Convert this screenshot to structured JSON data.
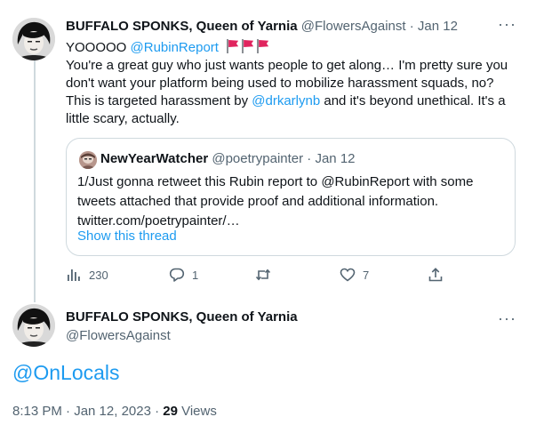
{
  "tweet1": {
    "author_name": "BUFFALO SPONKS, Queen of Yarnia",
    "handle": "@FlowersAgainst",
    "separator": "·",
    "date": "Jan 12",
    "more": "···",
    "line1_prefix": "YOOOOO ",
    "line1_mention": "@RubinReport",
    "body_part1": "You're a great guy who just wants people to get along… I'm pretty sure you don't want your platform being used to mobilize harassment squads, no? This is targeted harassment by ",
    "body_mention": "@drkarlynb",
    "body_part2": " and it's beyond unethical. It's a little scary, actually.",
    "flag_icon": "red-flag-icon",
    "quote": {
      "author_name": "NewYearWatcher",
      "handle": "@poetrypainter",
      "separator": "·",
      "date": "Jan 12",
      "text": "1/Just gonna retweet this Rubin report to @RubinReport with some tweets attached that provide proof and additional information. twitter.com/poetrypainter/…",
      "show_thread": "Show this thread"
    },
    "actions": {
      "views": "230",
      "replies": "1",
      "retweets": "",
      "likes": "7"
    }
  },
  "tweet2": {
    "author_name": "BUFFALO SPONKS, Queen of Yarnia",
    "handle": "@FlowersAgainst",
    "more": "···",
    "text": "@OnLocals",
    "time": "8:13 PM · Jan 12, 2023 · ",
    "views_count": "29",
    "views_label": " Views"
  },
  "colors": {
    "link": "#1d9bf0",
    "muted": "#536471",
    "text": "#0f1419",
    "border": "#cfd9de"
  }
}
